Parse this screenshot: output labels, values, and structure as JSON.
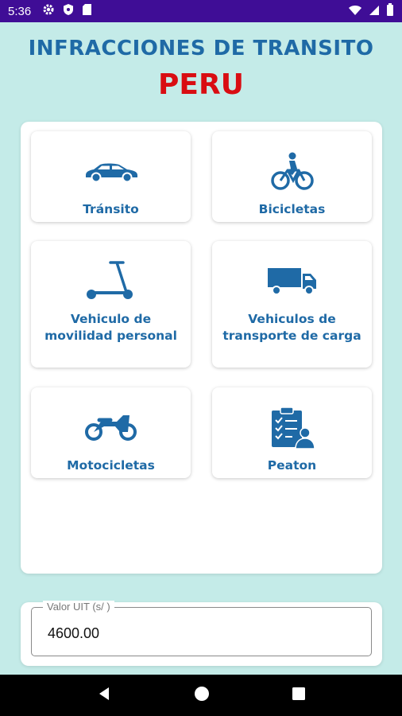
{
  "status_bar": {
    "time": "5:36",
    "left_icons": [
      "gear-icon",
      "shield-icon",
      "sd-card-icon"
    ],
    "right_icons": [
      "wifi-icon",
      "signal-icon",
      "battery-icon"
    ]
  },
  "header": {
    "title": "INFRACCIONES DE TRANSITO",
    "subtitle": "PERU",
    "title_color": "#1f6aa6",
    "subtitle_color": "#d90d12"
  },
  "categories": [
    {
      "label": "Tránsito",
      "icon": "car-icon"
    },
    {
      "label": "Bicicletas",
      "icon": "bicycle-icon"
    },
    {
      "label": "Vehiculo de movilidad personal",
      "icon": "scooter-icon"
    },
    {
      "label": "Vehiculos de transporte de carga",
      "icon": "truck-icon"
    },
    {
      "label": "Motocicletas",
      "icon": "motorcycle-icon"
    },
    {
      "label": "Peaton",
      "icon": "pedestrian-checklist-icon"
    }
  ],
  "uit": {
    "label": "Valor UIT (s/ )",
    "value": "4600.00"
  },
  "nav": {
    "buttons": [
      "back-icon",
      "home-icon",
      "recents-icon"
    ]
  },
  "colors": {
    "background": "#c4ebe8",
    "status_bar": "#3f0d96",
    "accent": "#1f6aa6"
  }
}
